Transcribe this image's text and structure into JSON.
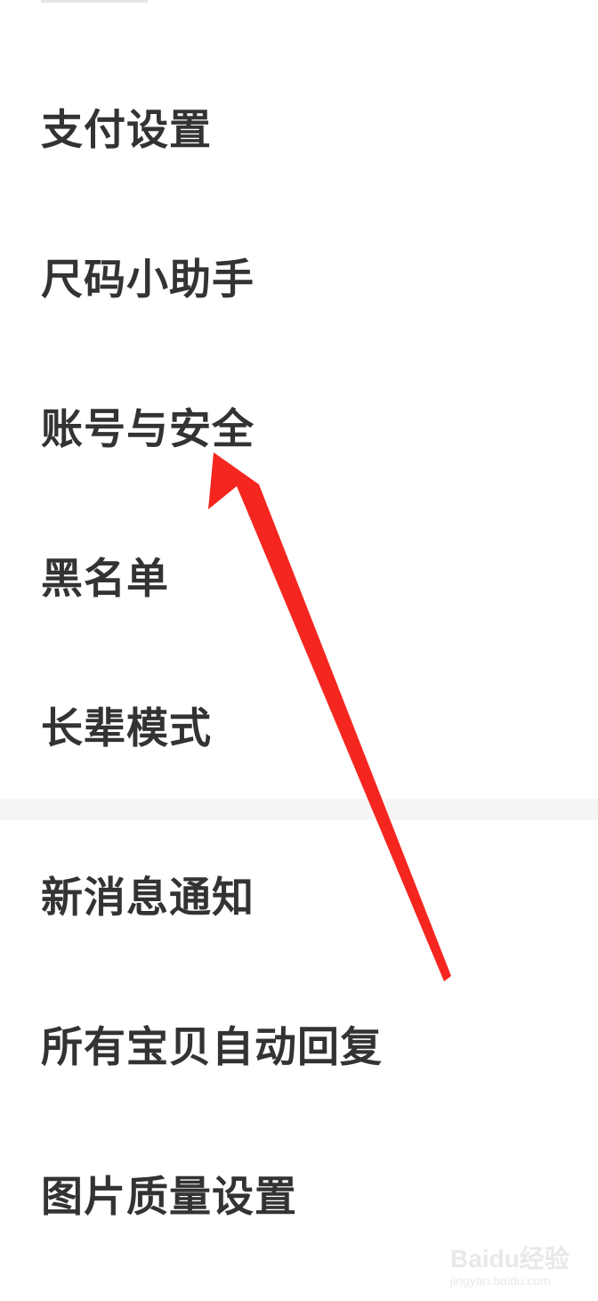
{
  "settings": {
    "items": [
      {
        "label": "支付设置"
      },
      {
        "label": "尺码小助手"
      },
      {
        "label": "账号与安全"
      },
      {
        "label": "黑名单"
      },
      {
        "label": "长辈模式"
      },
      {
        "label": "新消息通知"
      },
      {
        "label": "所有宝贝自动回复"
      },
      {
        "label": "图片质量设置"
      }
    ]
  },
  "annotation": {
    "arrow_color": "#f5261f",
    "target": "账号与安全"
  },
  "colors": {
    "text": "#333333",
    "background": "#ffffff",
    "section_gap": "#f5f5f5"
  },
  "watermark": {
    "logo_text": "Baidu经验",
    "subtext": "jingyan.baidu.com"
  }
}
